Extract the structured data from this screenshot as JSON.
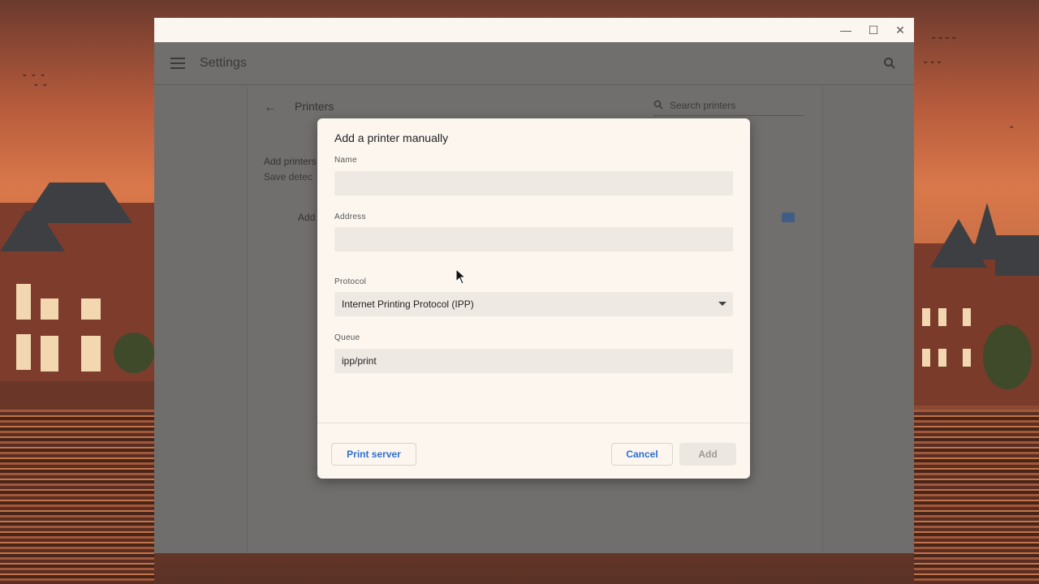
{
  "window": {
    "controls": {
      "minimize": "—",
      "maximize": "☐",
      "close": "✕"
    },
    "app_title": "Settings"
  },
  "printers_page": {
    "title": "Printers",
    "search_placeholder": "Search printers",
    "add_printers_heading": "Add printers",
    "save_detected_text": "Save detec",
    "add_row_label": "Add"
  },
  "dialog": {
    "title": "Add a printer manually",
    "name_label": "Name",
    "name_value": "",
    "address_label": "Address",
    "address_value": "",
    "protocol_label": "Protocol",
    "protocol_value": "Internet Printing Protocol (IPP)",
    "queue_label": "Queue",
    "queue_value": "ipp/print",
    "print_server_label": "Print server",
    "cancel_label": "Cancel",
    "add_label": "Add"
  },
  "colors": {
    "accent": "#2f6fd0",
    "dialog_bg": "#fcf6ef",
    "field_bg": "#efe9e3",
    "scrim": "#6f6e6c"
  },
  "icons": [
    "minimize-icon",
    "maximize-icon",
    "close-icon",
    "menu-icon",
    "search-icon",
    "back-arrow-icon",
    "add-printer-icon",
    "dropdown-caret-icon",
    "mouse-cursor-icon"
  ]
}
